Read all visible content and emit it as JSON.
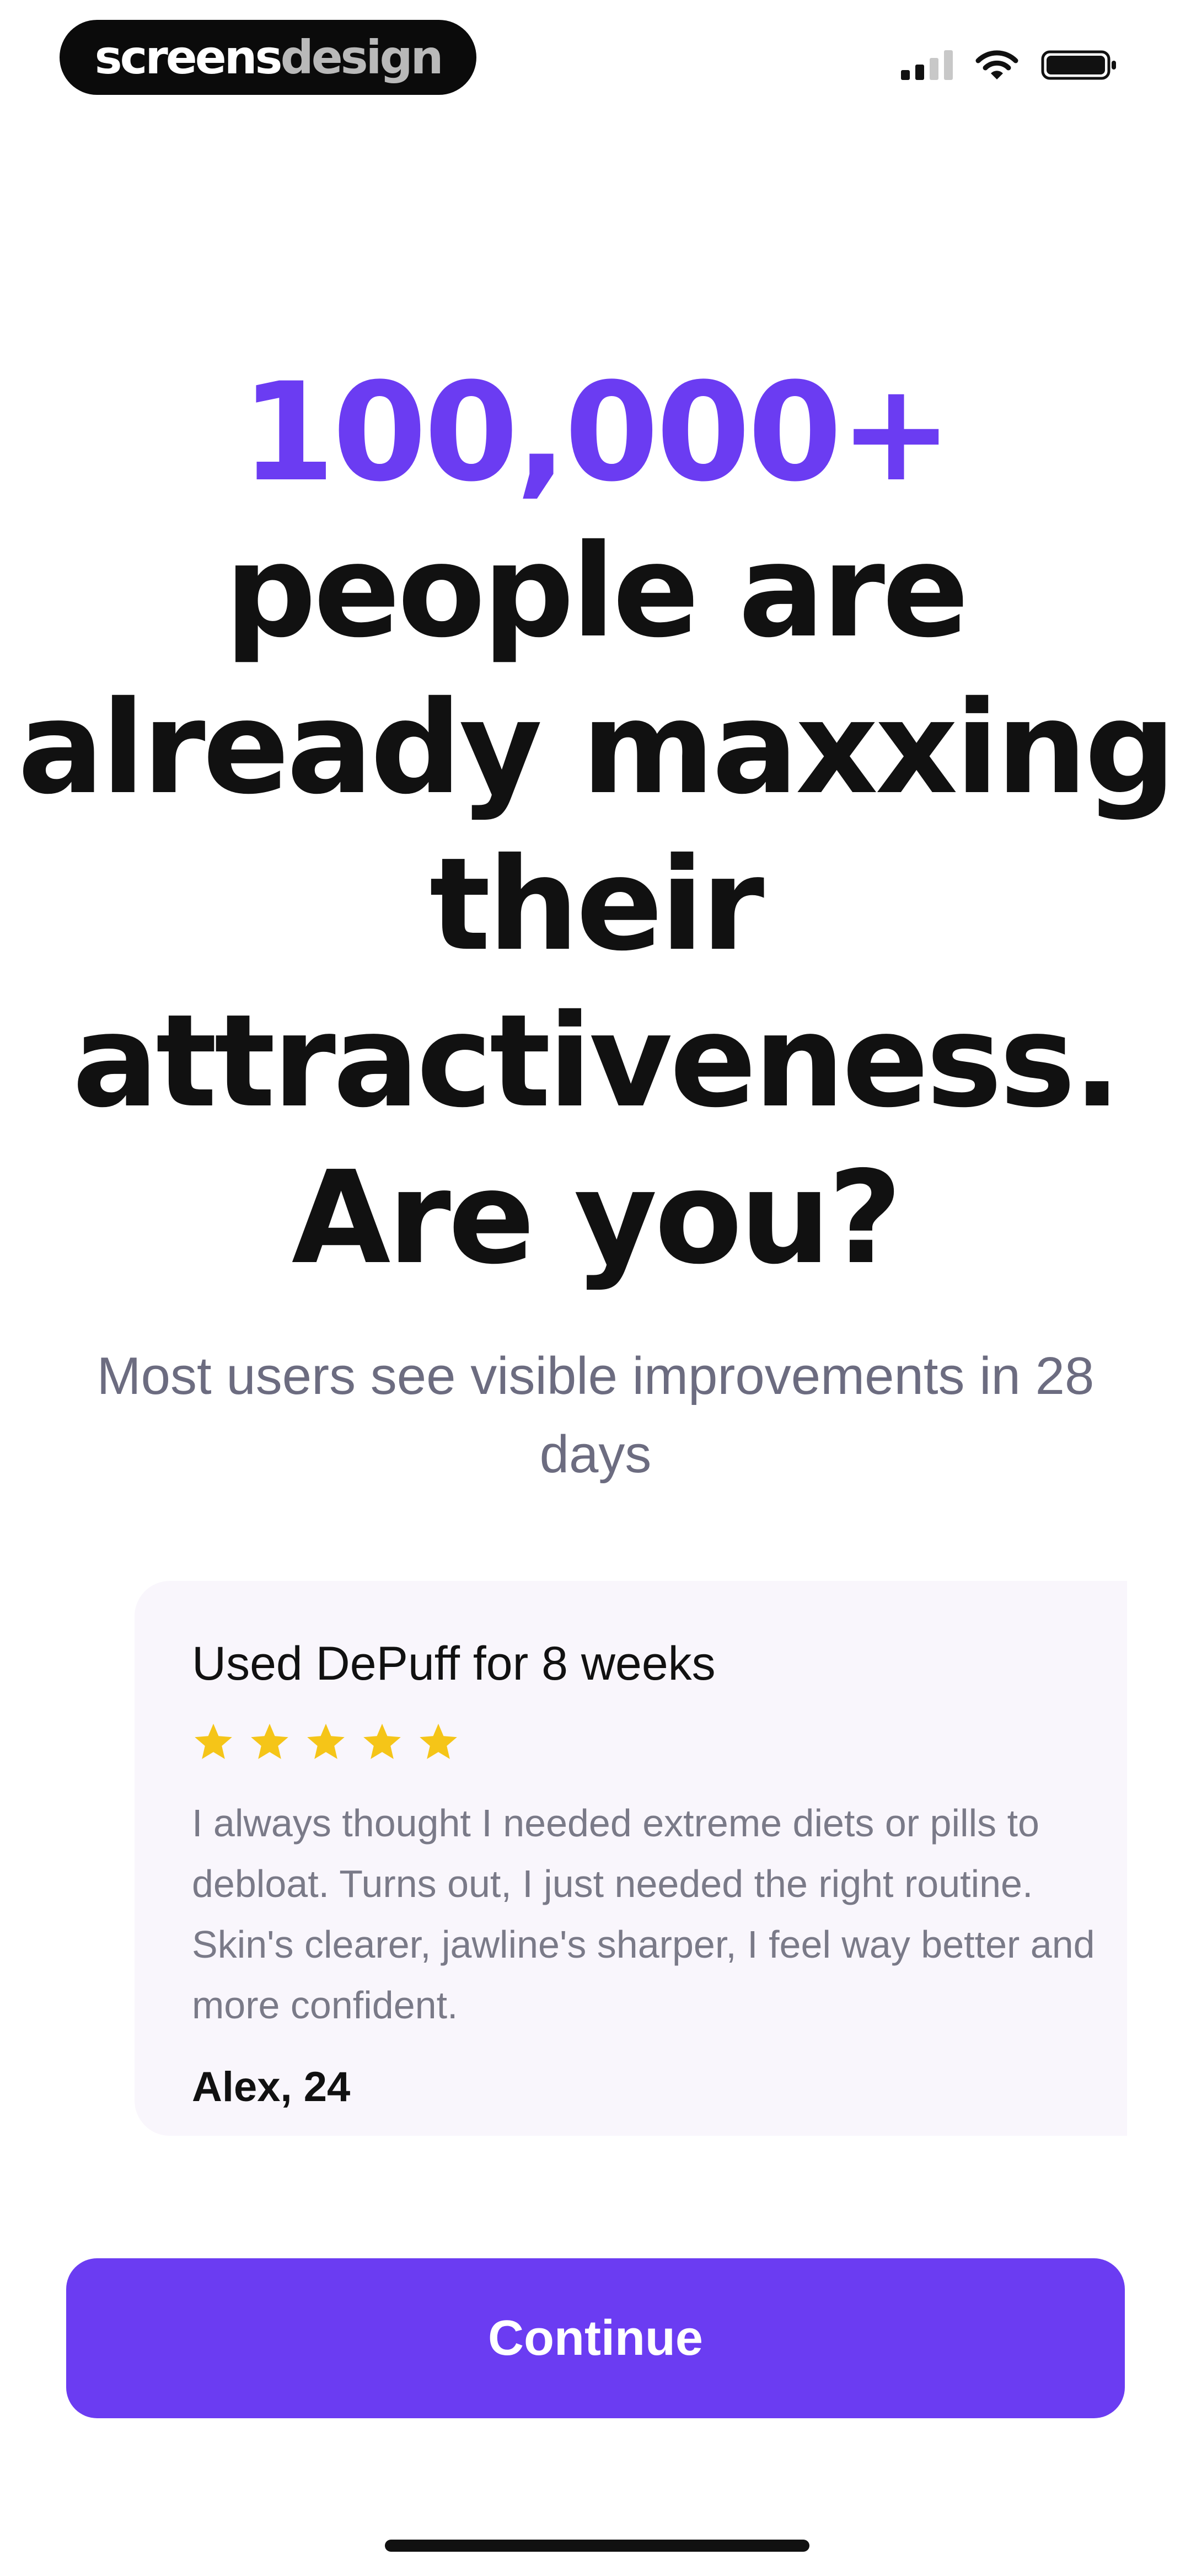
{
  "watermark": {
    "part1": "screens",
    "part2": "design"
  },
  "status_bar": {
    "signal_icon": "cellular-signal-icon",
    "wifi_icon": "wifi-icon",
    "battery_icon": "battery-icon"
  },
  "headline": {
    "number": "100,000+",
    "lines": [
      "people are",
      "already maxxing",
      "their",
      "attractiveness.",
      "Are you?"
    ]
  },
  "subtitle": "Most users see visible improvements in 28 days",
  "review": {
    "title": "Used DePuff for 8 weeks",
    "rating": 5,
    "body": "I always thought I needed extreme diets or pills to debloat. Turns out, I just needed the right routine. Skin's clearer, jawline's sharper, I feel way better and more confident.",
    "author": "Alex, 24"
  },
  "continue_button": {
    "label": "Continue"
  },
  "colors": {
    "accent": "#6b3cf2",
    "star": "#f5c518",
    "card_bg": "#f9f6fc",
    "muted_text": "#6c6c80"
  }
}
